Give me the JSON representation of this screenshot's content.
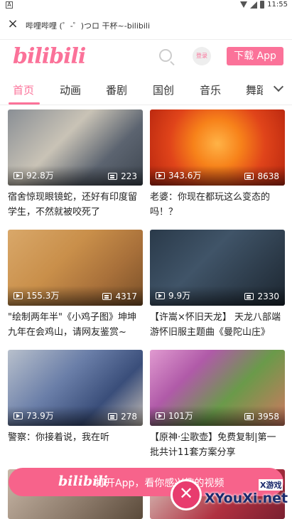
{
  "status_bar": {
    "left_icon": "A",
    "time": "11:55"
  },
  "title_bar": {
    "title": "哔哩哔哩 (゜-゜)つロ 干杯~-bilibili"
  },
  "header": {
    "logo": "bilibili",
    "login_label": "登录",
    "download_label": "下载 App"
  },
  "tabs": [
    {
      "label": "首页",
      "active": true
    },
    {
      "label": "动画"
    },
    {
      "label": "番剧"
    },
    {
      "label": "国创"
    },
    {
      "label": "音乐"
    },
    {
      "label": "舞蹈"
    }
  ],
  "videos": [
    {
      "views": "92.8万",
      "danmaku": "223",
      "title": "宿舍惊现眼镜蛇，还好有印度留学生，不然就被咬死了"
    },
    {
      "views": "343.6万",
      "danmaku": "8638",
      "title": "老婆：你现在都玩这么变态的吗！？"
    },
    {
      "views": "155.3万",
      "danmaku": "4317",
      "title": "\"绘制两年半\"《小鸡子图》坤坤九年在会鸡山，请网友鉴赏~"
    },
    {
      "views": "9.9万",
      "danmaku": "2330",
      "title": "【许嵩×怀旧天龙】 天龙八部端游怀旧服主题曲《曼陀山庄》"
    },
    {
      "views": "73.9万",
      "danmaku": "278",
      "title": "警察：你接着说，我在听"
    },
    {
      "views": "101万",
      "danmaku": "3958",
      "title": "【原神·尘歌壶】免费复制|第一批共计11套方案分享"
    }
  ],
  "banner": {
    "logo": "bilibili",
    "text": "打开App，看你感兴趣的视频"
  },
  "watermark": {
    "site": "XYouXi.net",
    "badge": "X游戏"
  }
}
